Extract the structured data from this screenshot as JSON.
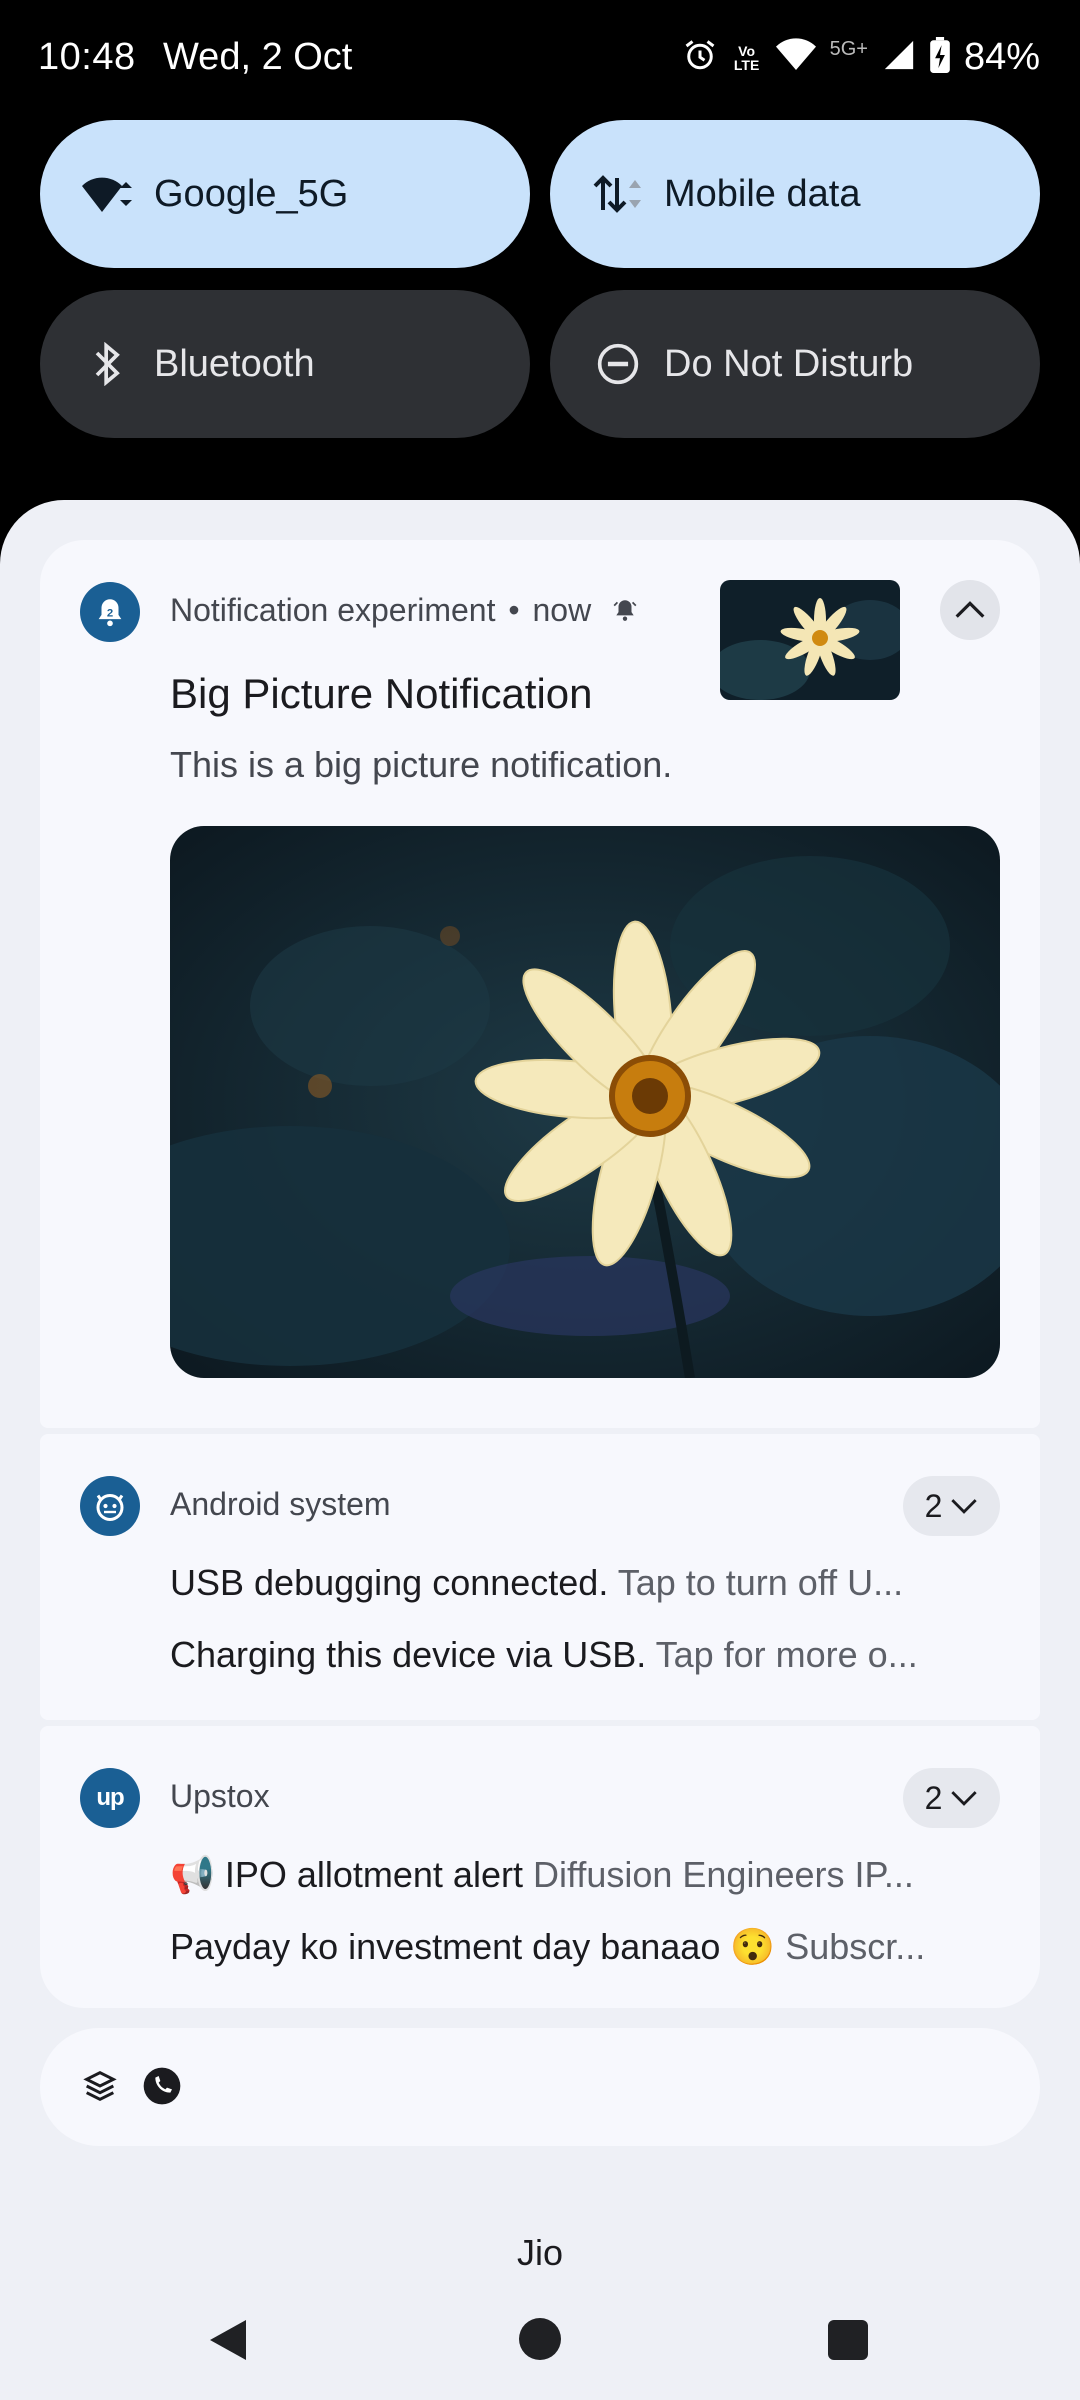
{
  "status_bar": {
    "time": "10:48",
    "date": "Wed, 2 Oct",
    "icons": [
      "alarm-icon",
      "volte-icon",
      "wifi-icon",
      "5g-icon",
      "signal-icon",
      "battery-icon"
    ],
    "network_label": "5G+",
    "volte_label": "Vo LTE",
    "battery": "84%"
  },
  "quick_settings": {
    "tiles": [
      {
        "label": "Google_5G",
        "icon": "wifi-icon",
        "state": "on"
      },
      {
        "label": "Mobile data",
        "icon": "mobile-data-icon",
        "state": "on"
      },
      {
        "label": "Bluetooth",
        "icon": "bluetooth-icon",
        "state": "off"
      },
      {
        "label": "Do Not Disturb",
        "icon": "dnd-icon",
        "state": "off"
      }
    ]
  },
  "notifications": {
    "big_picture": {
      "app_name": "Notification experiment",
      "time": "now",
      "separator": "•",
      "title": "Big Picture Notification",
      "text": "This is a big picture notification.",
      "icon": "notification-bell-icon"
    },
    "android_system": {
      "app_name": "Android system",
      "count": "2",
      "messages": [
        {
          "title": "USB debugging connected.",
          "text": "Tap to turn off U..."
        },
        {
          "title": "Charging this device via USB.",
          "text": "Tap for more o..."
        }
      ]
    },
    "upstox": {
      "app_name": "Upstox",
      "count": "2",
      "messages": [
        {
          "title": "📢 IPO allotment alert",
          "text": "Diffusion Engineers IP..."
        },
        {
          "title": "Payday ko investment day banaao 😯",
          "text": "Subscr..."
        }
      ]
    }
  },
  "carrier": "Jio",
  "colors": {
    "tile_on": "#c9e2fb",
    "tile_off": "#2e3034",
    "app_icon": "#1a5f94",
    "shade_bg": "#eef0f6",
    "card_bg": "#f7f8fd"
  }
}
